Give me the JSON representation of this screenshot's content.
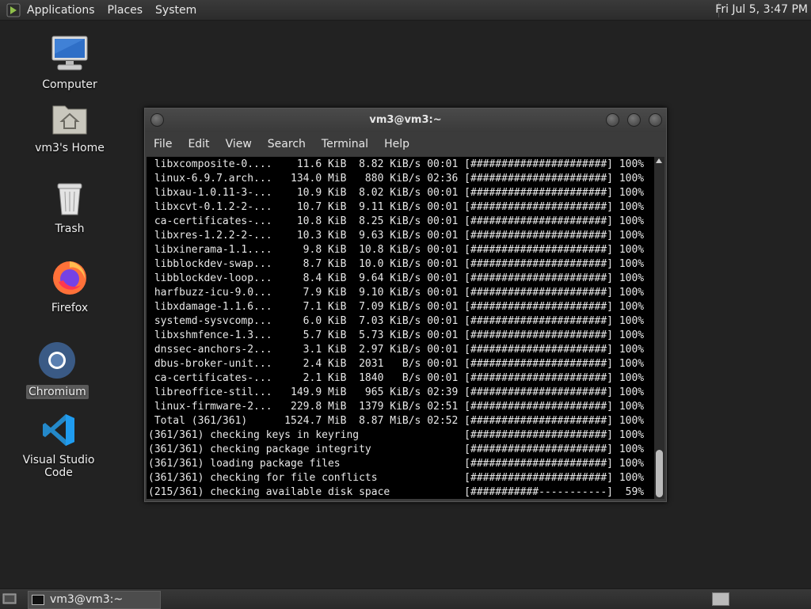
{
  "top_panel": {
    "menus": [
      "Applications",
      "Places",
      "System"
    ],
    "clock": "Fri Jul  5,  3:47 PM"
  },
  "desktop": {
    "icons": [
      {
        "label": "Computer",
        "icon": "computer-icon"
      },
      {
        "label": "vm3's Home",
        "icon": "home-folder-icon"
      },
      {
        "label": "Trash",
        "icon": "trash-icon"
      },
      {
        "label": "Firefox",
        "icon": "firefox-icon"
      },
      {
        "label": "Chromium",
        "icon": "chromium-icon",
        "selected": true
      },
      {
        "label": "Visual Studio Code",
        "icon": "vscode-icon"
      }
    ]
  },
  "terminal": {
    "title": "vm3@vm3:~",
    "menu": [
      "File",
      "Edit",
      "View",
      "Search",
      "Terminal",
      "Help"
    ],
    "lines": [
      " libxcomposite-0....    11.6 KiB  8.82 KiB/s 00:01 [######################] 100%",
      " linux-6.9.7.arch...   134.0 MiB   880 KiB/s 02:36 [######################] 100%",
      " libxau-1.0.11-3-...    10.9 KiB  8.02 KiB/s 00:01 [######################] 100%",
      " libxcvt-0.1.2-2-...    10.7 KiB  9.11 KiB/s 00:01 [######################] 100%",
      " ca-certificates-...    10.8 KiB  8.25 KiB/s 00:01 [######################] 100%",
      " libxres-1.2.2-2-...    10.3 KiB  9.63 KiB/s 00:01 [######################] 100%",
      " libxinerama-1.1....     9.8 KiB  10.8 KiB/s 00:01 [######################] 100%",
      " libblockdev-swap...     8.7 KiB  10.0 KiB/s 00:01 [######################] 100%",
      " libblockdev-loop...     8.4 KiB  9.64 KiB/s 00:01 [######################] 100%",
      " harfbuzz-icu-9.0...     7.9 KiB  9.10 KiB/s 00:01 [######################] 100%",
      " libxdamage-1.1.6...     7.1 KiB  7.09 KiB/s 00:01 [######################] 100%",
      " systemd-sysvcomp...     6.0 KiB  7.03 KiB/s 00:01 [######################] 100%",
      " libxshmfence-1.3...     5.7 KiB  5.73 KiB/s 00:01 [######################] 100%",
      " dnssec-anchors-2...     3.1 KiB  2.97 KiB/s 00:01 [######################] 100%",
      " dbus-broker-unit...     2.4 KiB  2031   B/s 00:01 [######################] 100%",
      " ca-certificates-...     2.1 KiB  1840   B/s 00:01 [######################] 100%",
      " libreoffice-stil...   149.9 MiB   965 KiB/s 02:39 [######################] 100%",
      " linux-firmware-2...   229.8 MiB  1379 KiB/s 02:51 [######################] 100%",
      " Total (361/361)      1524.7 MiB  8.87 MiB/s 02:52 [######################] 100%",
      "(361/361) checking keys in keyring                 [######################] 100%",
      "(361/361) checking package integrity               [######################] 100%",
      "(361/361) loading package files                    [######################] 100%",
      "(361/361) checking for file conflicts              [######################] 100%",
      "(215/361) checking available disk space            [###########-----------]  59%"
    ]
  },
  "taskbar": {
    "items": [
      {
        "label": "vm3@vm3:~"
      }
    ]
  }
}
